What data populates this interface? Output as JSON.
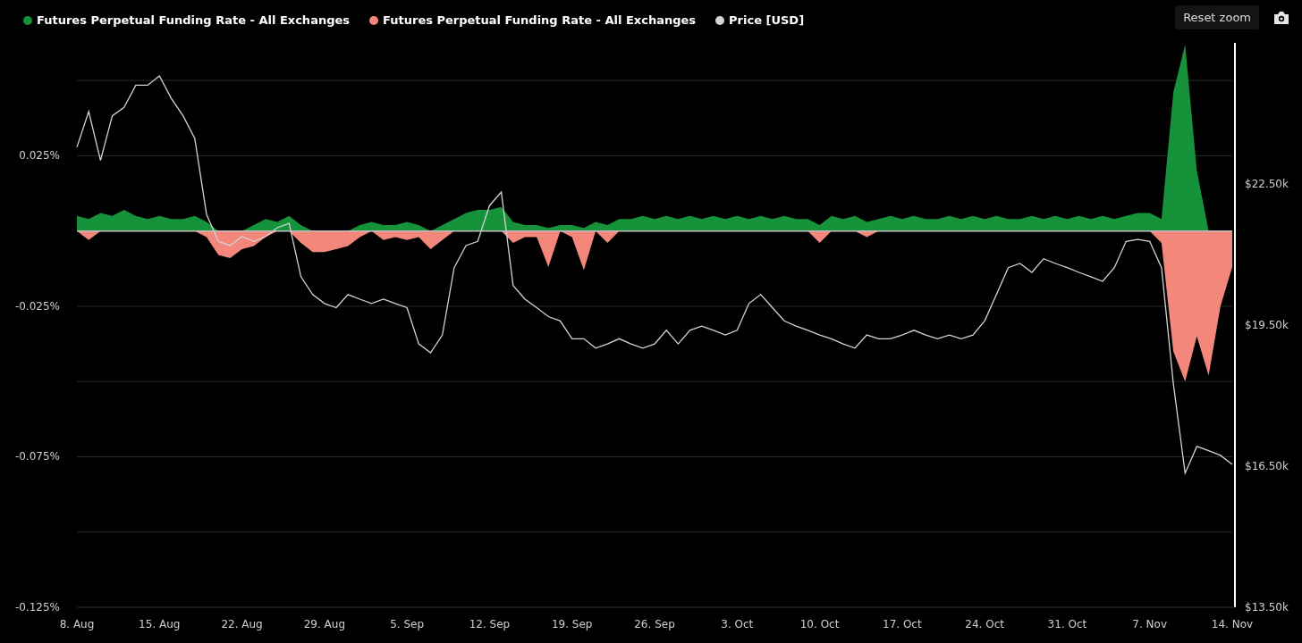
{
  "reset_zoom": {
    "label": "Reset zoom"
  },
  "chart": {
    "chart_data": {
      "type": "area",
      "categories": [
        "8. Aug",
        null,
        null,
        null,
        null,
        null,
        null,
        "15. Aug",
        null,
        null,
        null,
        null,
        null,
        null,
        "22. Aug",
        null,
        null,
        null,
        null,
        null,
        null,
        "29. Aug",
        null,
        null,
        null,
        null,
        null,
        null,
        "5. Sep",
        null,
        null,
        null,
        null,
        null,
        null,
        "12. Sep",
        null,
        null,
        null,
        null,
        null,
        null,
        "19. Sep",
        null,
        null,
        null,
        null,
        null,
        null,
        "26. Sep",
        null,
        null,
        null,
        null,
        null,
        null,
        "3. Oct",
        null,
        null,
        null,
        null,
        null,
        null,
        "10. Oct",
        null,
        null,
        null,
        null,
        null,
        null,
        "17. Oct",
        null,
        null,
        null,
        null,
        null,
        null,
        "24. Oct",
        null,
        null,
        null,
        null,
        null,
        null,
        "31. Oct",
        null,
        null,
        null,
        null,
        null,
        null,
        "7. Nov",
        null,
        null,
        null,
        null,
        null,
        null,
        "14. Nov"
      ],
      "series": [
        {
          "name": "Futures Perpetual Funding Rate - All Exchanges",
          "color": "#16923a",
          "values": [
            0.005,
            0.004,
            0.006,
            0.005,
            0.007,
            0.005,
            0.004,
            0.005,
            0.004,
            0.004,
            0.005,
            0.003,
            0,
            0,
            0,
            0.002,
            0.004,
            0.003,
            0.005,
            0.002,
            0,
            0,
            0,
            0,
            0.002,
            0.003,
            0.002,
            0.002,
            0.003,
            0.002,
            0,
            0.002,
            0.004,
            0.006,
            0.007,
            0.007,
            0.008,
            0.003,
            0.002,
            0.002,
            0.001,
            0.002,
            0.002,
            0.001,
            0.003,
            0.002,
            0.004,
            0.004,
            0.005,
            0.004,
            0.005,
            0.004,
            0.005,
            0.004,
            0.005,
            0.004,
            0.005,
            0.004,
            0.005,
            0.004,
            0.005,
            0.004,
            0.004,
            0.002,
            0.005,
            0.004,
            0.005,
            0.003,
            0.004,
            0.005,
            0.004,
            0.005,
            0.004,
            0.004,
            0.005,
            0.004,
            0.005,
            0.004,
            0.005,
            0.004,
            0.004,
            0.005,
            0.004,
            0.005,
            0.004,
            0.005,
            0.004,
            0.005,
            0.004,
            0.005,
            0.006,
            0.006,
            0.004,
            0.046,
            0.062,
            0.02,
            0,
            0,
            0
          ]
        },
        {
          "name": "Futures Perpetual Funding Rate - All Exchanges",
          "color": "#f4877b",
          "values": [
            0,
            -0.003,
            0,
            0,
            0,
            0,
            0,
            0,
            0,
            0,
            0,
            -0.002,
            -0.008,
            -0.009,
            -0.006,
            -0.005,
            -0.002,
            0,
            0,
            -0.004,
            -0.007,
            -0.007,
            -0.006,
            -0.005,
            -0.002,
            0,
            -0.003,
            -0.002,
            -0.003,
            -0.002,
            -0.006,
            -0.003,
            0,
            0,
            0,
            0,
            0,
            -0.004,
            -0.002,
            -0.002,
            -0.012,
            0,
            -0.002,
            -0.013,
            0,
            -0.004,
            0,
            0,
            0,
            0,
            0,
            0,
            0,
            0,
            0,
            0,
            0,
            0,
            0,
            0,
            0,
            0,
            0,
            -0.004,
            0,
            0,
            0,
            -0.002,
            0,
            0,
            0,
            0,
            0,
            0,
            0,
            0,
            0,
            0,
            0,
            0,
            0,
            0,
            0,
            0,
            0,
            0,
            0,
            0,
            0,
            0,
            0,
            0,
            -0.004,
            -0.04,
            -0.05,
            -0.035,
            -0.048,
            -0.025,
            -0.012
          ]
        },
        {
          "name": "Price [USD]",
          "color": "#d4d4d4",
          "axis": "y2",
          "type": "line",
          "values": [
            23280,
            24040,
            23000,
            23950,
            24130,
            24600,
            24600,
            24800,
            24320,
            23950,
            23470,
            21850,
            21280,
            21190,
            21380,
            21280,
            21380,
            21570,
            21660,
            20530,
            20150,
            19960,
            19870,
            20150,
            20050,
            19960,
            20050,
            19960,
            19870,
            19100,
            18910,
            19290,
            20720,
            21190,
            21280,
            22040,
            22330,
            20340,
            20050,
            19870,
            19680,
            19590,
            19210,
            19210,
            19010,
            19100,
            19210,
            19100,
            19010,
            19100,
            19390,
            19100,
            19390,
            19480,
            19390,
            19290,
            19390,
            19960,
            20150,
            19870,
            19590,
            19480,
            19390,
            19290,
            19210,
            19100,
            19010,
            19290,
            19210,
            19210,
            19290,
            19390,
            19290,
            19210,
            19290,
            19210,
            19290,
            19590,
            20150,
            20720,
            20810,
            20620,
            20910,
            20810,
            20720,
            20620,
            20530,
            20430,
            20720,
            21280,
            21320,
            21280,
            20720,
            18260,
            16350,
            16920,
            16830,
            16730,
            16540
          ]
        }
      ],
      "grid": true,
      "ylim": [
        -0.125,
        0.0625
      ],
      "yticks": [
        {
          "value": 0.025,
          "label": "0.025%"
        },
        {
          "value": -0.025,
          "label": "-0.025%"
        },
        {
          "value": -0.075,
          "label": "-0.075%"
        },
        {
          "value": -0.125,
          "label": "-0.125%"
        }
      ],
      "y2lim": [
        13500,
        25500
      ],
      "y2ticks": [
        {
          "value": 22500,
          "label": "$22.50k"
        },
        {
          "value": 19500,
          "label": "$19.50k"
        },
        {
          "value": 16500,
          "label": "$16.50k"
        },
        {
          "value": 13500,
          "label": "$13.50k"
        }
      ]
    }
  }
}
